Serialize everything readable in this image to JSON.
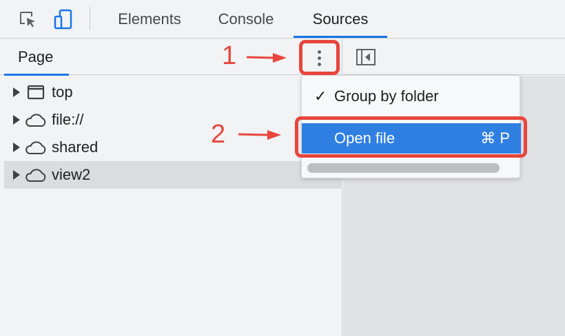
{
  "toolbar": {
    "inspect_icon": "inspect-element-icon",
    "device_icon": "device-toggle-icon",
    "tabs": [
      {
        "label": "Elements",
        "active": false
      },
      {
        "label": "Console",
        "active": false
      },
      {
        "label": "Sources",
        "active": true
      }
    ],
    "accent_color": "#1a73e8"
  },
  "navigator": {
    "tab_label": "Page",
    "more_icon": "more-vertical-icon",
    "items": [
      {
        "label": "top",
        "icon": "frame-icon",
        "selected": false
      },
      {
        "label": "file://",
        "icon": "cloud-icon",
        "selected": false
      },
      {
        "label": "shared",
        "icon": "cloud-icon",
        "selected": false
      },
      {
        "label": "view2",
        "icon": "cloud-icon",
        "selected": true
      }
    ]
  },
  "right_panel": {
    "toggle_icon": "sidebar-toggle-icon"
  },
  "menu": {
    "items": [
      {
        "label": "Group by folder",
        "checked": true,
        "shortcut": "",
        "highlighted": false
      },
      {
        "label": "Open file",
        "checked": false,
        "shortcut": "⌘ P",
        "highlighted": true
      }
    ],
    "highlight_color": "#2f7fe3"
  },
  "annotations": {
    "step1": "1",
    "step2": "2",
    "color": "#e8453c"
  }
}
